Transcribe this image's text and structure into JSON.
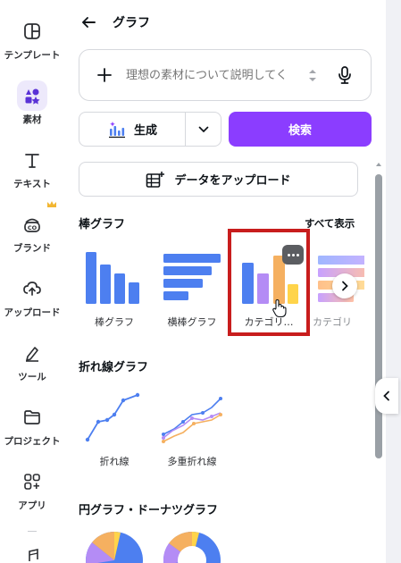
{
  "rail": {
    "items": [
      {
        "label": "テンプレート",
        "icon": "template-icon"
      },
      {
        "label": "素材",
        "icon": "elements-icon",
        "active": true
      },
      {
        "label": "テキスト",
        "icon": "text-icon"
      },
      {
        "label": "ブランド",
        "icon": "brand-icon",
        "badge": "crown-icon"
      },
      {
        "label": "アップロード",
        "icon": "cloud-upload-icon"
      },
      {
        "label": "ツール",
        "icon": "pen-tool-icon"
      },
      {
        "label": "プロジェクト",
        "icon": "folder-icon"
      },
      {
        "label": "アプリ",
        "icon": "apps-grid-icon"
      }
    ]
  },
  "header": {
    "title": "グラフ"
  },
  "prompt": {
    "placeholder": "理想の素材について説明してく"
  },
  "actions": {
    "generate_label": "生成",
    "search_label": "検索",
    "upload_label": "データをアップロード"
  },
  "sections": {
    "bar": {
      "title": "棒グラフ",
      "see_all": "すべて表示",
      "tiles": [
        {
          "label": "棒グラフ"
        },
        {
          "label": "横棒グラフ"
        },
        {
          "label": "カテゴリ…"
        },
        {
          "label": "カテゴリ"
        }
      ]
    },
    "line": {
      "title": "折れ線グラフ",
      "tiles": [
        {
          "label": "折れ線"
        },
        {
          "label": "多重折れ線"
        }
      ]
    },
    "pie": {
      "title": "円グラフ・ドーナツグラフ"
    }
  },
  "colors": {
    "accent": "#8b3dff",
    "blue": "#4d7ff0",
    "purple": "#b48cf5",
    "orange": "#f5b060",
    "yellow": "#ffd44a",
    "highlight": "#c81d1d"
  }
}
